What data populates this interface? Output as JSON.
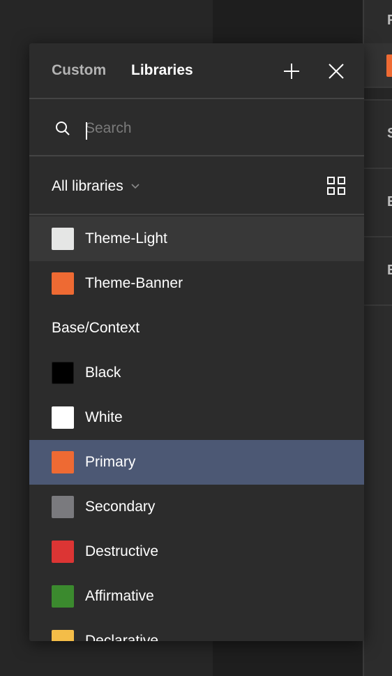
{
  "right_panel": {
    "letters": [
      "F",
      "S",
      "E",
      "E"
    ],
    "swatch_color": "#ee6a33"
  },
  "popover": {
    "tabs": [
      {
        "label": "Custom",
        "active": false
      },
      {
        "label": "Libraries",
        "active": true
      }
    ],
    "add_icon": "plus-icon",
    "close_icon": "close-icon",
    "search": {
      "value": "",
      "placeholder": "Search",
      "icon": "search-icon"
    },
    "filter": {
      "selected": "All libraries",
      "chevron_icon": "chevron-down-icon",
      "view_icon": "grid-view-icon"
    },
    "items": [
      {
        "type": "style",
        "label": "Theme-Light",
        "color": "#e5e6e5",
        "state": "hover"
      },
      {
        "type": "style",
        "label": "Theme-Banner",
        "color": "#ee6a33",
        "state": ""
      },
      {
        "type": "group",
        "label": "Base/Context"
      },
      {
        "type": "style",
        "label": "Black",
        "color": "#000000",
        "state": ""
      },
      {
        "type": "style",
        "label": "White",
        "color": "#ffffff",
        "state": ""
      },
      {
        "type": "style",
        "label": "Primary",
        "color": "#ee6a33",
        "state": "selected"
      },
      {
        "type": "style",
        "label": "Secondary",
        "color": "#7a7a7e",
        "state": ""
      },
      {
        "type": "style",
        "label": "Destructive",
        "color": "#dc3534",
        "state": ""
      },
      {
        "type": "style",
        "label": "Affirmative",
        "color": "#3b8a2e",
        "state": ""
      },
      {
        "type": "style",
        "label": "Declarative",
        "color": "#f4bd48",
        "state": ""
      }
    ]
  },
  "colors": {
    "selected_bg": "#4c5874",
    "hover_bg": "#383838",
    "panel_bg": "#2c2c2c"
  }
}
